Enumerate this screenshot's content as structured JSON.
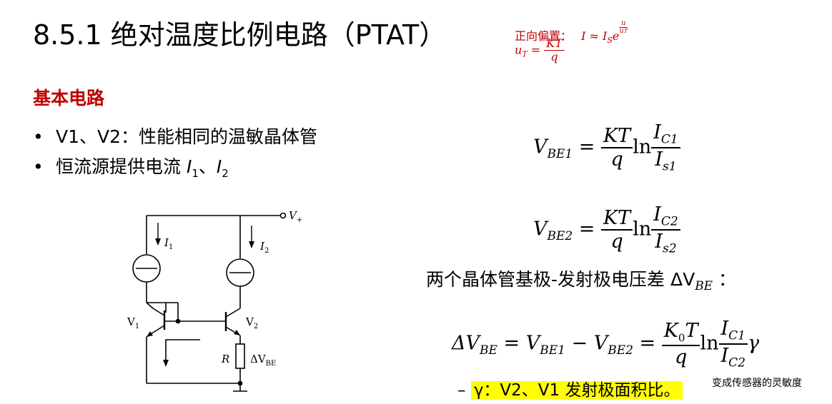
{
  "title": "8.5.1 绝对温度比例电路（PTAT）",
  "note": {
    "forward_bias_label": "正向偏置：",
    "forward_bias_formula": "I ≈ I",
    "forward_bias_sub": "S",
    "forward_bias_e": "e",
    "exp_num": "u",
    "exp_den": "u",
    "exp_den_sub": "T",
    "ut_lhs": "u",
    "ut_sub": "T",
    "ut_eq": " = ",
    "ut_num": "KT",
    "ut_den": "q"
  },
  "section_heading": "基本电路",
  "bullets": [
    {
      "marker": "•",
      "text": "V1、V2：性能相同的温敏晶体管"
    },
    {
      "marker": "•",
      "text_a": "恒流源提供电流 ",
      "i1": "I",
      "i1_sub": "1",
      "sep": "、",
      "i2": "I",
      "i2_sub": "2"
    }
  ],
  "eq1": {
    "lhs": "V",
    "lhs_sub": "BE1",
    "eq": " = ",
    "num": "KT",
    "den": "q",
    "ln": "ln",
    "fnum": "I",
    "fnum_sub": "C1",
    "fden": "I",
    "fden_sub": "s1"
  },
  "eq2": {
    "lhs": "V",
    "lhs_sub": "BE2",
    "eq": " = ",
    "num": "KT",
    "den": "q",
    "ln": "ln",
    "fnum": "I",
    "fnum_sub": "C2",
    "fden": "I",
    "fden_sub": "s2"
  },
  "diff_text": "两个晶体管基极-发射极电压差 ΔV",
  "diff_sub": "BE",
  "diff_colon": " ：",
  "eq3": {
    "lhs": "ΔV",
    "lhs_sub": "BE",
    "eq1": " = ",
    "a": "V",
    "a_sub": "BE1",
    "minus": " − ",
    "b": "V",
    "b_sub": "BE2",
    "eq2": " = ",
    "num": "K",
    "num_sub": "0",
    "num_t": "T",
    "den": "q",
    "ln": "ln",
    "fnum": "I",
    "fnum_sub": "C1",
    "fden": "I",
    "fden_sub": "C2",
    "tail": "γ"
  },
  "gamma_line": {
    "dash": "– ",
    "text": "γ：V2、V1 发射极面积比。"
  },
  "side_note": "变成传感器的灵敏度",
  "circuit": {
    "vplus": "V",
    "vplus_sub": "+",
    "i1": "I",
    "i1_sub": "1",
    "i2": "I",
    "i2_sub": "2",
    "v1": "V",
    "v1_sub": "1",
    "v2": "V",
    "v2_sub": "2",
    "r": "R",
    "dvbe": "ΔV",
    "dvbe_sub": "BE"
  },
  "colors": {
    "accent_red": "#c00000",
    "highlight": "#ffff00"
  }
}
